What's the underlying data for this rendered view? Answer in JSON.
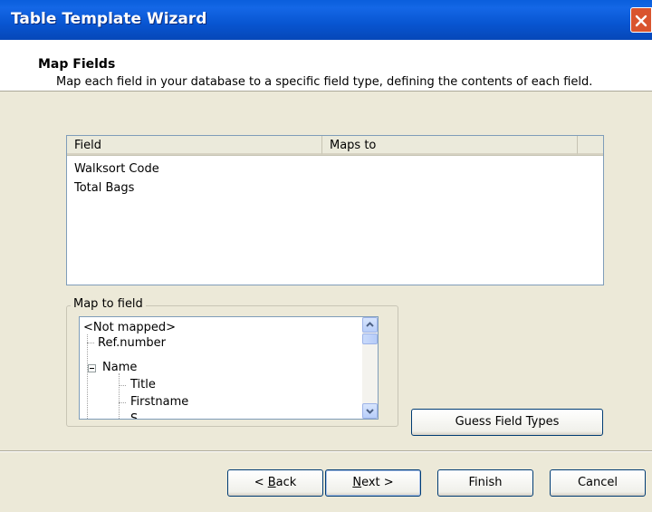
{
  "window": {
    "title": "Table Template Wizard"
  },
  "header": {
    "title": "Map Fields",
    "subtitle": "Map each field in your database to a specific field type, defining the contents of each field."
  },
  "list": {
    "columns": [
      "Field",
      "Maps to"
    ],
    "rows": [
      {
        "field": "Walksort Code",
        "maps_to": ""
      },
      {
        "field": "Total Bags",
        "maps_to": ""
      }
    ]
  },
  "map_to_field": {
    "label": "Map to field",
    "items": [
      "<Not mapped>",
      "Ref.number",
      "Name",
      "Title",
      "Firstname",
      "S"
    ]
  },
  "buttons": {
    "guess": "Guess Field Types",
    "back_prefix": "< ",
    "back_key": "B",
    "back_rest": "ack",
    "next_key": "N",
    "next_rest": "ext >",
    "finish": "Finish",
    "cancel": "Cancel"
  },
  "colors": {
    "titlebar": "#0A5EDC",
    "close": "#D9542E",
    "face": "#ECE9D8"
  }
}
